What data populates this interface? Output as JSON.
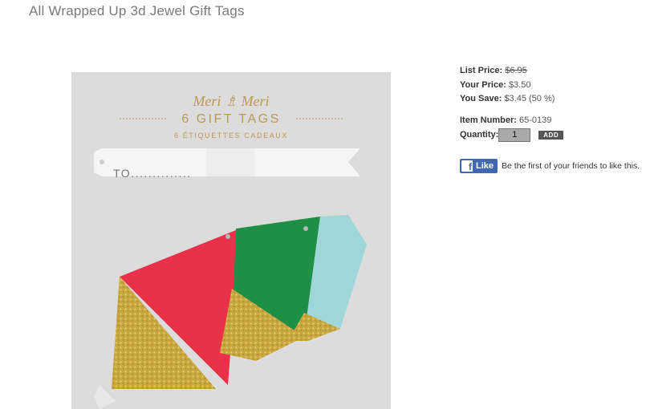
{
  "product": {
    "title": "All Wrapped Up 3d Jewel Gift Tags",
    "image": {
      "brand": "Meri ♗ Meri",
      "heading": "6 GIFT TAGS",
      "subheading": "6 ÉTIQUETTES CADEAUX",
      "tag_text": "TO..............",
      "colors": {
        "red": "#e9314a",
        "green": "#1f8f47",
        "blue": "#9fd6d8",
        "gold": "#c9a73e",
        "card": "#dcdcdc"
      }
    }
  },
  "pricing": {
    "list_price_label": "List Price:",
    "list_price": "$6.95",
    "your_price_label": "Your Price:",
    "your_price": "$3.50",
    "you_save_label": "You Save:",
    "you_save": "$3.45 (50 %)"
  },
  "item": {
    "number_label": "Item Number:",
    "number": "65-0139",
    "quantity_label": "Quantity:",
    "quantity": "1",
    "add_label": "ADD"
  },
  "social": {
    "like_label": "Like",
    "like_text": "Be the first of your friends to like this.",
    "brand_color": "#4267b2"
  }
}
